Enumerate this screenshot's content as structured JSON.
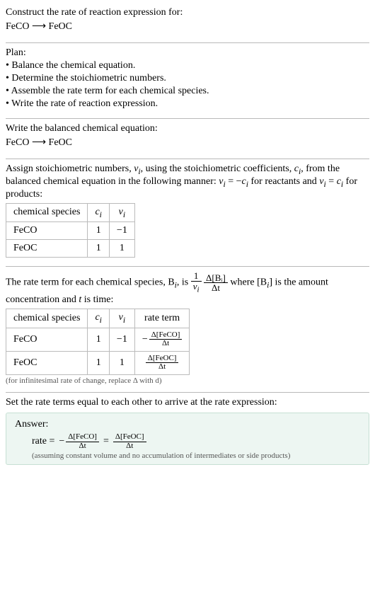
{
  "header": {
    "title": "Construct the rate of reaction expression for:",
    "equation_lhs": "FeCO",
    "arrow": "⟶",
    "equation_rhs": "FeOC"
  },
  "plan": {
    "label": "Plan:",
    "items": [
      "• Balance the chemical equation.",
      "• Determine the stoichiometric numbers.",
      "• Assemble the rate term for each chemical species.",
      "• Write the rate of reaction expression."
    ]
  },
  "balanced": {
    "title": "Write the balanced chemical equation:",
    "lhs": "FeCO",
    "arrow": "⟶",
    "rhs": "FeOC"
  },
  "assign": {
    "text_parts": {
      "p1": "Assign stoichiometric numbers, ",
      "nu_i": "ν",
      "sub_i": "i",
      "p2": ", using the stoichiometric coefficients, ",
      "c_i": "c",
      "p3": ", from the balanced chemical equation in the following manner: ",
      "eq1": " = −",
      "p4": " for reactants and ",
      "eq2": " = ",
      "p5": " for products:"
    },
    "table_headers": [
      "chemical species",
      "cᵢ",
      "νᵢ"
    ],
    "rows": [
      {
        "species": "FeCO",
        "c": "1",
        "nu": "−1"
      },
      {
        "species": "FeOC",
        "c": "1",
        "nu": "1"
      }
    ]
  },
  "rate_term": {
    "text": {
      "p1": "The rate term for each chemical species, B",
      "sub_i": "i",
      "p2": ", is ",
      "one_over_nu_num": "1",
      "one_over_nu_den_sym": "ν",
      "deltaB_num": "Δ[Bᵢ]",
      "deltaB_den": "Δt",
      "p3": " where [B",
      "p4": "] is the amount concentration and ",
      "t": "t",
      "p5": " is time:"
    },
    "table_headers": [
      "chemical species",
      "cᵢ",
      "νᵢ",
      "rate term"
    ],
    "rows": [
      {
        "species": "FeCO",
        "c": "1",
        "nu": "−1",
        "rate_num": "Δ[FeCO]",
        "rate_den": "Δt",
        "neg": "−"
      },
      {
        "species": "FeOC",
        "c": "1",
        "nu": "1",
        "rate_num": "Δ[FeOC]",
        "rate_den": "Δt",
        "neg": ""
      }
    ],
    "note": "(for infinitesimal rate of change, replace Δ with d)"
  },
  "final": {
    "intro": "Set the rate terms equal to each other to arrive at the rate expression:",
    "answer_label": "Answer:",
    "rate_label": "rate =",
    "neg": "−",
    "lhs_num": "Δ[FeCO]",
    "lhs_den": "Δt",
    "eq": "=",
    "rhs_num": "Δ[FeOC]",
    "rhs_den": "Δt",
    "note": "(assuming constant volume and no accumulation of intermediates or side products)"
  },
  "chart_data": {
    "type": "table",
    "tables": [
      {
        "title": "Stoichiometric numbers",
        "headers": [
          "chemical species",
          "c_i",
          "nu_i"
        ],
        "rows": [
          [
            "FeCO",
            1,
            -1
          ],
          [
            "FeOC",
            1,
            1
          ]
        ]
      },
      {
        "title": "Rate terms",
        "headers": [
          "chemical species",
          "c_i",
          "nu_i",
          "rate term"
        ],
        "rows": [
          [
            "FeCO",
            1,
            -1,
            "-Δ[FeCO]/Δt"
          ],
          [
            "FeOC",
            1,
            1,
            "Δ[FeOC]/Δt"
          ]
        ]
      }
    ]
  }
}
